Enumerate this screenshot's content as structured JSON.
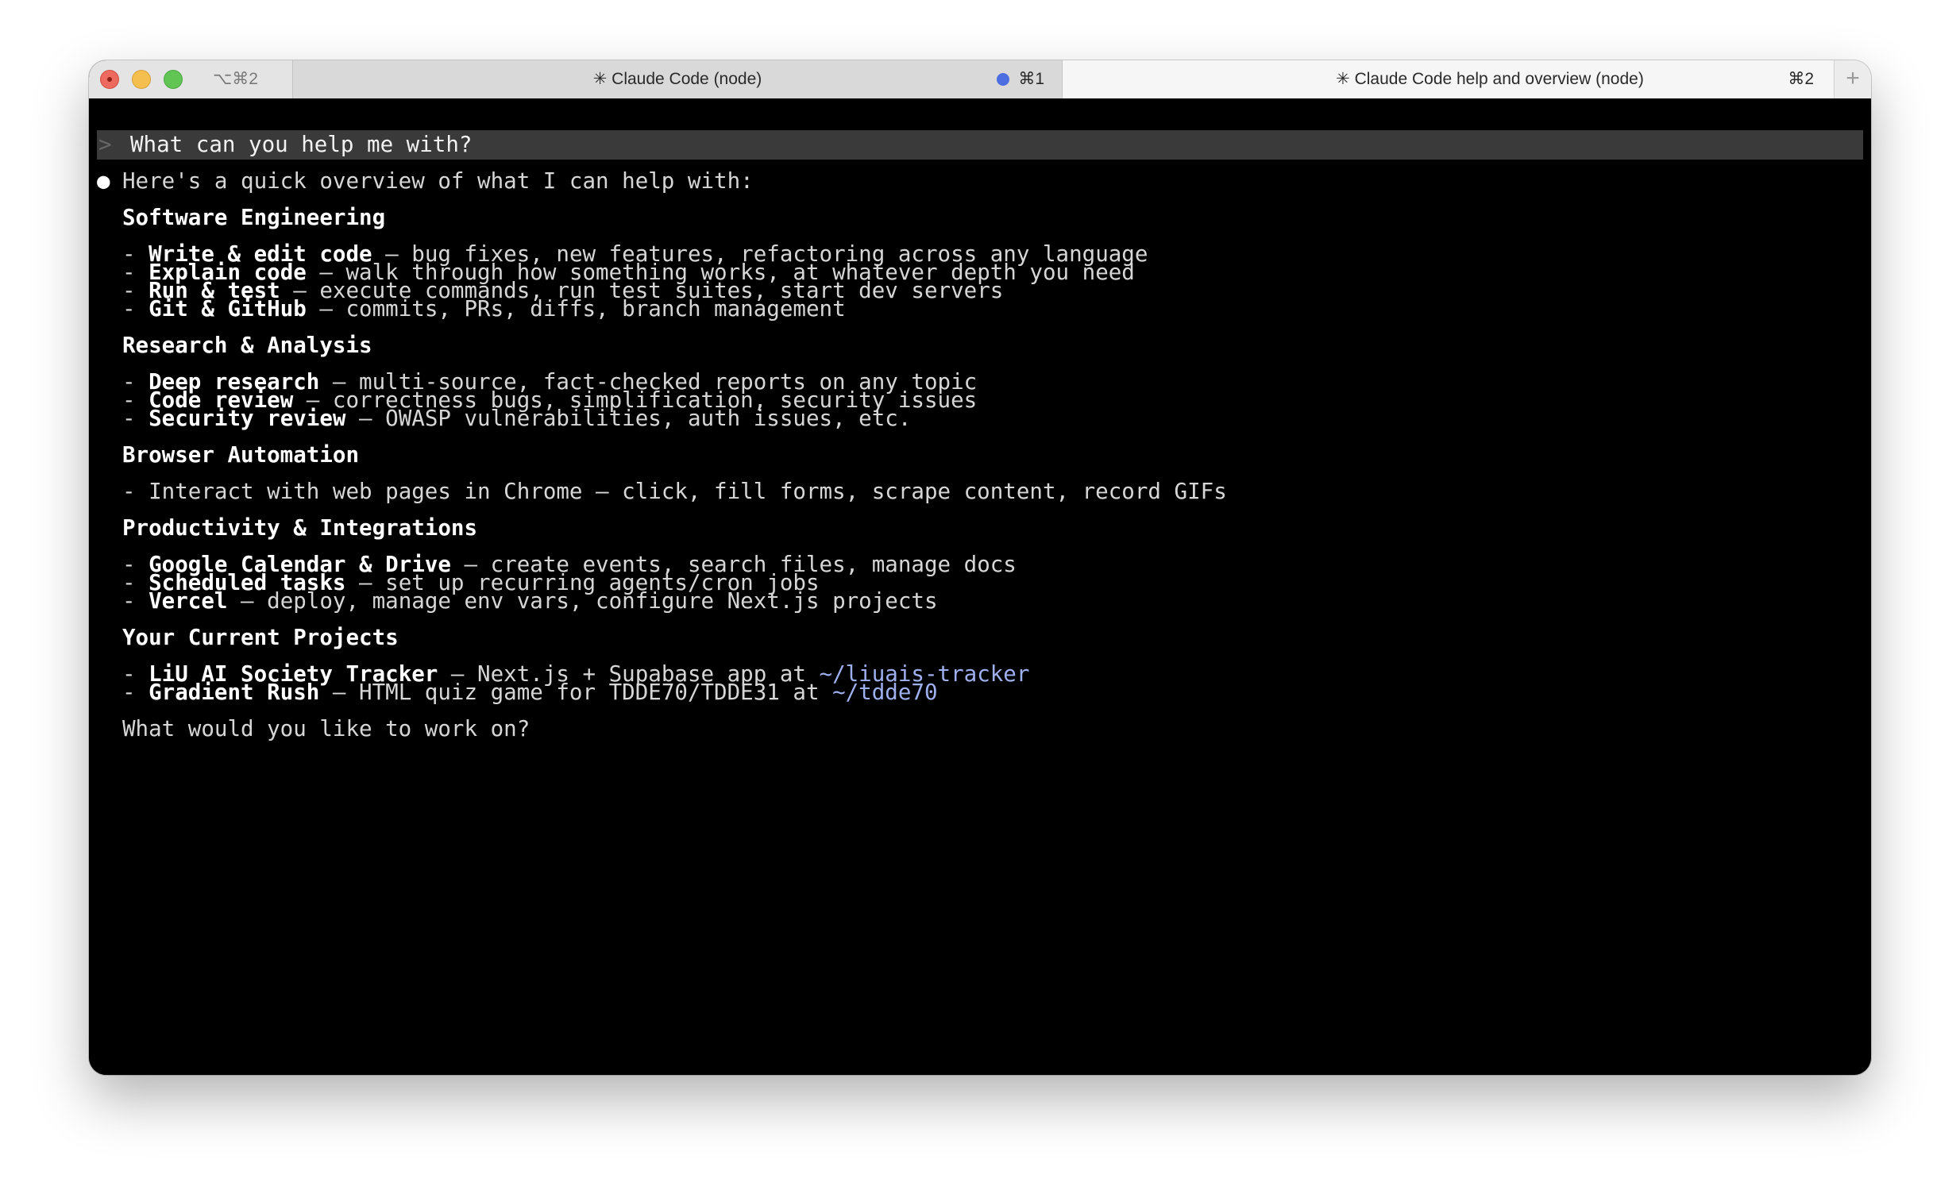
{
  "titlebar": {
    "shortcut_left": "⌥⌘2",
    "tabs": [
      {
        "title": "✳ Claude Code (node)",
        "shortcut": "⌘1",
        "activity_dot_color": "#4c6ee0"
      },
      {
        "title": "✳ Claude Code help and overview (node)",
        "shortcut": "⌘2"
      }
    ],
    "new_tab": "+"
  },
  "terminal": {
    "prompt_chevron": ">",
    "prompt": "What can you help me with?",
    "response_bullet": "●",
    "intro": "Here's a quick overview of what I can help with:",
    "sections": [
      {
        "heading": "Software Engineering",
        "items": [
          {
            "bold": "Write & edit code",
            "rest": " – bug fixes, new features, refactoring across any language"
          },
          {
            "bold": "Explain code",
            "rest": " – walk through how something works, at whatever depth you need"
          },
          {
            "bold": "Run & test",
            "rest": " – execute commands, run test suites, start dev servers"
          },
          {
            "bold": "Git & GitHub",
            "rest": " – commits, PRs, diffs, branch management"
          }
        ]
      },
      {
        "heading": "Research & Analysis",
        "items": [
          {
            "bold": "Deep research",
            "rest": " – multi-source, fact-checked reports on any topic"
          },
          {
            "bold": "Code review",
            "rest": " – correctness bugs, simplification, security issues"
          },
          {
            "bold": "Security review",
            "rest": " – OWASP vulnerabilities, auth issues, etc."
          }
        ]
      },
      {
        "heading": "Browser Automation",
        "items": [
          {
            "bold": "",
            "rest": "Interact with web pages in Chrome – click, fill forms, scrape content, record GIFs"
          }
        ]
      },
      {
        "heading": "Productivity & Integrations",
        "items": [
          {
            "bold": "Google Calendar & Drive",
            "rest": " – create events, search files, manage docs"
          },
          {
            "bold": "Scheduled tasks",
            "rest": " – set up recurring agents/cron jobs"
          },
          {
            "bold": "Vercel",
            "rest": " – deploy, manage env vars, configure Next.js projects"
          }
        ]
      },
      {
        "heading": "Your Current Projects",
        "items": [
          {
            "bold": "LiU AI Society Tracker",
            "rest": " – Next.js + Supabase app at ",
            "link": "~/liuais-tracker"
          },
          {
            "bold": "Gradient Rush",
            "rest": " – HTML quiz game for TDDE70/TDDE31 at ",
            "link": "~/tdde70"
          }
        ]
      }
    ],
    "closing": "What would you like to work on?"
  }
}
